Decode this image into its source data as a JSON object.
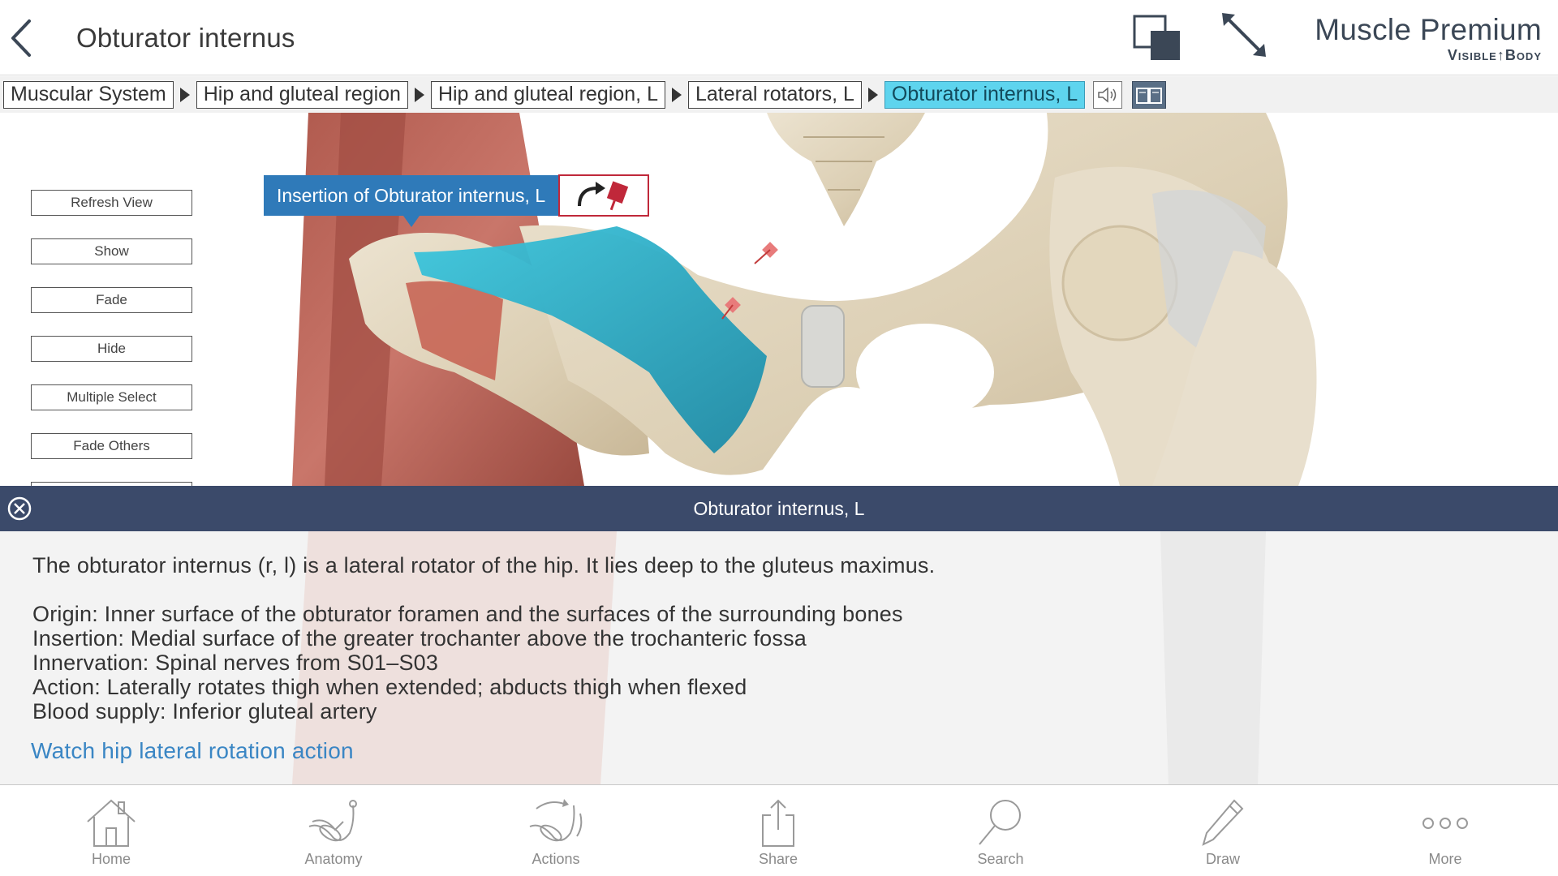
{
  "header": {
    "title": "Obturator internus",
    "brand_name": "Muscle Premium",
    "brand_sub": "Visible↑Body"
  },
  "breadcrumb": {
    "items": [
      {
        "label": "Muscular System",
        "active": false
      },
      {
        "label": "Hip and gluteal region",
        "active": false
      },
      {
        "label": "Hip and gluteal region, L",
        "active": false
      },
      {
        "label": "Lateral rotators, L",
        "active": false
      },
      {
        "label": "Obturator internus, L",
        "active": true
      }
    ]
  },
  "sidebar": {
    "buttons": [
      "Refresh View",
      "Show",
      "Fade",
      "Hide",
      "Multiple Select",
      "Fade Others"
    ]
  },
  "callout": {
    "label": "Insertion of Obturator internus, L"
  },
  "panel": {
    "title": "Obturator internus, L",
    "description": "The obturator internus (r, l) is a lateral rotator of the hip. It lies deep to the gluteus maximus.",
    "facts": [
      "Origin: Inner surface of the obturator foramen and the surfaces of the surrounding bones",
      "Insertion: Medial surface of the greater trochanter above the trochanteric fossa",
      "Innervation: Spinal nerves from S01–S03",
      "Action: Laterally rotates thigh when extended; abducts thigh when flexed",
      "Blood supply: Inferior gluteal artery"
    ],
    "link": "Watch hip lateral rotation action"
  },
  "tabbar": {
    "tabs": [
      {
        "label": "Home",
        "icon": "home-icon"
      },
      {
        "label": "Anatomy",
        "icon": "anatomy-icon"
      },
      {
        "label": "Actions",
        "icon": "actions-icon"
      },
      {
        "label": "Share",
        "icon": "share-icon"
      },
      {
        "label": "Search",
        "icon": "search-icon"
      },
      {
        "label": "Draw",
        "icon": "pencil-icon"
      },
      {
        "label": "More",
        "icon": "more-icon"
      }
    ]
  },
  "colors": {
    "accent": "#5ed4ee",
    "panel_header": "#3b4a6a",
    "callout": "#2f7ab9",
    "link": "#3a86c4",
    "highlighted_muscle": "#2aa9c4"
  }
}
